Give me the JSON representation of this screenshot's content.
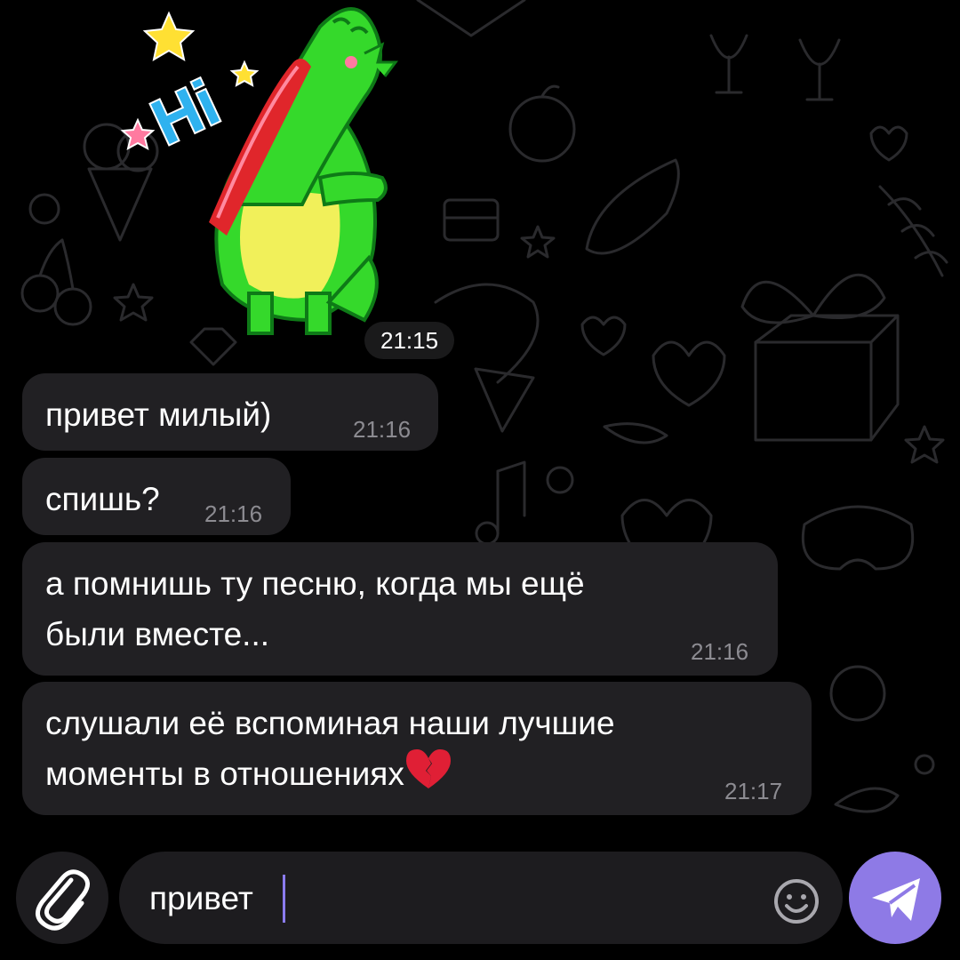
{
  "sticker": {
    "greeting": "Hi",
    "time": "21:15"
  },
  "messages": [
    {
      "lines": [
        "привет милый)"
      ],
      "time": "21:16"
    },
    {
      "lines": [
        "спишь?"
      ],
      "time": "21:16"
    },
    {
      "lines": [
        "а помнишь ту песню, когда мы ещё",
        "были вместе..."
      ],
      "time": "21:16"
    },
    {
      "lines": [
        "слушали её вспоминая наши лучшие",
        "моменты в отношениях"
      ],
      "emoji": "broken-heart",
      "time": "21:17"
    }
  ],
  "composer": {
    "input_value": "привет",
    "attach_icon": "paperclip-icon",
    "emoji_icon": "smiley-icon",
    "send_icon": "send-arrow-icon"
  },
  "colors": {
    "background": "#000000",
    "bubble": "#212023",
    "timestamp": "#8c8b91",
    "accent": "#8e7ae6",
    "sticker_green": "#35d92b",
    "sticker_belly": "#f1f05a",
    "sticker_mouth": "#e0262b",
    "sticker_text": "#2fb2ef"
  }
}
